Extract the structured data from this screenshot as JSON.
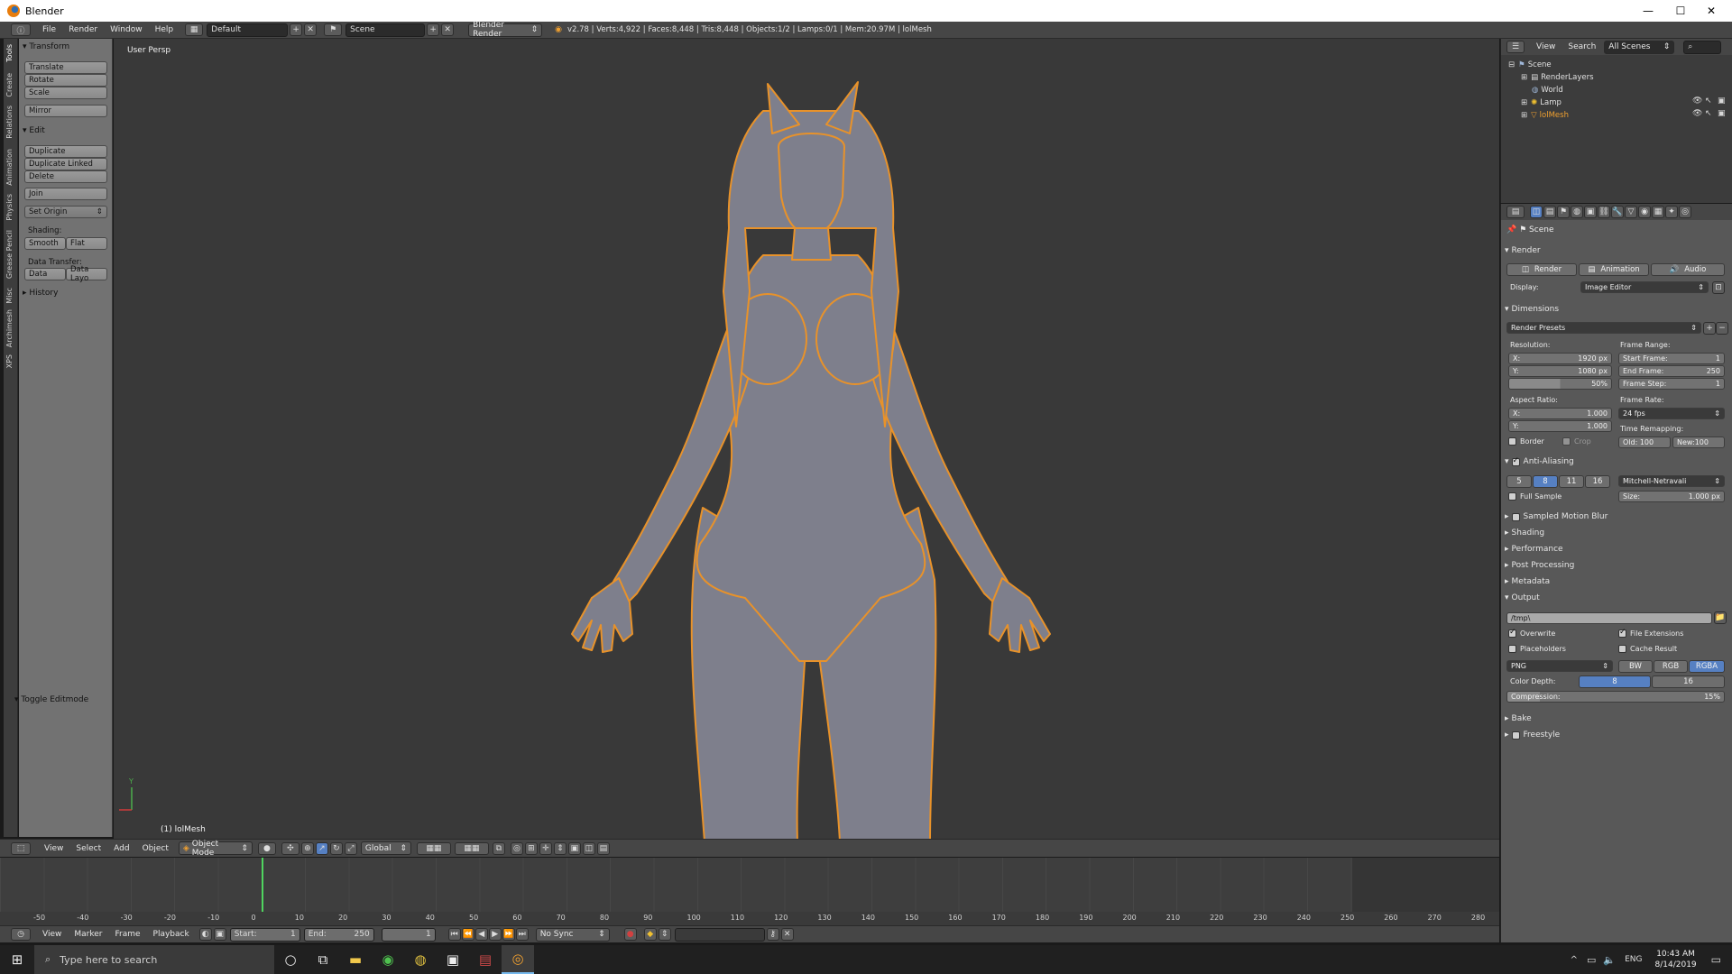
{
  "window": {
    "title": "Blender",
    "minimize": "—",
    "maximize": "☐",
    "close": "✕"
  },
  "info_header": {
    "menus": [
      "File",
      "Render",
      "Window",
      "Help"
    ],
    "screen_layout": "Default",
    "scene": "Scene",
    "engine": "Blender Render",
    "stats": "v2.78 | Verts:4,922 | Faces:8,448 | Tris:8,448 | Objects:1/2 | Lamps:0/1 | Mem:20.97M | lolMesh"
  },
  "tool_tabs": [
    "Tools",
    "Create",
    "Relations",
    "Animation",
    "Physics",
    "Grease Pencil",
    "Misc",
    "Archimesh",
    "XPS"
  ],
  "toolshelf": {
    "transform": {
      "header": "Transform",
      "translate": "Translate",
      "rotate": "Rotate",
      "scale": "Scale",
      "mirror": "Mirror"
    },
    "edit": {
      "header": "Edit",
      "duplicate": "Duplicate",
      "duplicate_linked": "Duplicate Linked",
      "delete": "Delete",
      "join": "Join",
      "set_origin": "Set Origin"
    },
    "shading": {
      "label": "Shading:",
      "smooth": "Smooth",
      "flat": "Flat"
    },
    "data_transfer": {
      "label": "Data Transfer:",
      "data": "Data",
      "data_layout": "Data Layo"
    },
    "history": "History",
    "toggle_editmode": "Toggle Editmode"
  },
  "viewport": {
    "view_name": "User Persp",
    "active_object": "(1) lolMesh",
    "object_fill": "#7e7f8c",
    "selection_outline": "#e8922a"
  },
  "viewport_header": {
    "menus": [
      "View",
      "Select",
      "Add",
      "Object"
    ],
    "mode": "Object Mode",
    "orientation": "Global"
  },
  "timeline": {
    "ruler": [
      "-50",
      "-40",
      "-30",
      "-20",
      "-10",
      "0",
      "10",
      "20",
      "30",
      "40",
      "50",
      "60",
      "70",
      "80",
      "90",
      "100",
      "110",
      "120",
      "130",
      "140",
      "150",
      "160",
      "170",
      "180",
      "190",
      "200",
      "210",
      "220",
      "230",
      "240",
      "250",
      "260",
      "270",
      "280"
    ],
    "current_frame": 1,
    "menus": [
      "View",
      "Marker",
      "Frame",
      "Playback"
    ],
    "start_label": "Start:",
    "start": "1",
    "end_label": "End:",
    "end": "250",
    "frame": "1",
    "sync": "No Sync"
  },
  "outliner": {
    "menus": [
      "View",
      "Search"
    ],
    "filter": "All Scenes",
    "items": [
      {
        "label": "Scene"
      },
      {
        "label": "RenderLayers"
      },
      {
        "label": "World"
      },
      {
        "label": "Lamp"
      },
      {
        "label": "lolMesh"
      }
    ]
  },
  "properties": {
    "context": "Scene",
    "render": {
      "header": "Render",
      "buttons": [
        "Render",
        "Animation",
        "Audio"
      ],
      "display_label": "Display:",
      "display": "Image Editor"
    },
    "dimensions": {
      "header": "Dimensions",
      "presets": "Render Presets",
      "resolution_label": "Resolution:",
      "res_x_label": "X:",
      "res_x": "1920 px",
      "res_y_label": "Y:",
      "res_y": "1080 px",
      "res_pct": "50%",
      "aspect_label": "Aspect Ratio:",
      "aspect_x_label": "X:",
      "aspect_x": "1.000",
      "aspect_y_label": "Y:",
      "aspect_y": "1.000",
      "border": "Border",
      "crop": "Crop",
      "frame_range_label": "Frame Range:",
      "start_frame_label": "Start Frame:",
      "start_frame": "1",
      "end_frame_label": "End Frame:",
      "end_frame": "250",
      "frame_step_label": "Frame Step:",
      "frame_step": "1",
      "frame_rate_label": "Frame Rate:",
      "frame_rate": "24 fps",
      "time_remap_label": "Time Remapping:",
      "old": "Old: 100",
      "new": "New:100"
    },
    "anti_aliasing": {
      "header": "Anti-Aliasing",
      "samples": [
        "5",
        "8",
        "11",
        "16"
      ],
      "selected_sample": "8",
      "filter": "Mitchell-Netravali",
      "full_sample": "Full Sample",
      "size_label": "Size:",
      "size": "1.000 px"
    },
    "collapsed_sections": [
      "Sampled Motion Blur",
      "Shading",
      "Performance",
      "Post Processing",
      "Metadata"
    ],
    "output": {
      "header": "Output",
      "path": "/tmp\\",
      "overwrite": "Overwrite",
      "file_extensions": "File Extensions",
      "placeholders": "Placeholders",
      "cache_result": "Cache Result",
      "format": "PNG",
      "color_modes": [
        "BW",
        "RGB",
        "RGBA"
      ],
      "selected_color_mode": "RGBA",
      "color_depth_label": "Color Depth:",
      "depths": [
        "8",
        "16"
      ],
      "compression_label": "Compression:",
      "compression": "15%"
    },
    "bake": "Bake",
    "freestyle": "Freestyle"
  },
  "taskbar": {
    "search_placeholder": "Type here to search",
    "time": "10:43 AM",
    "date": "8/14/2019",
    "lang": "ENG"
  }
}
